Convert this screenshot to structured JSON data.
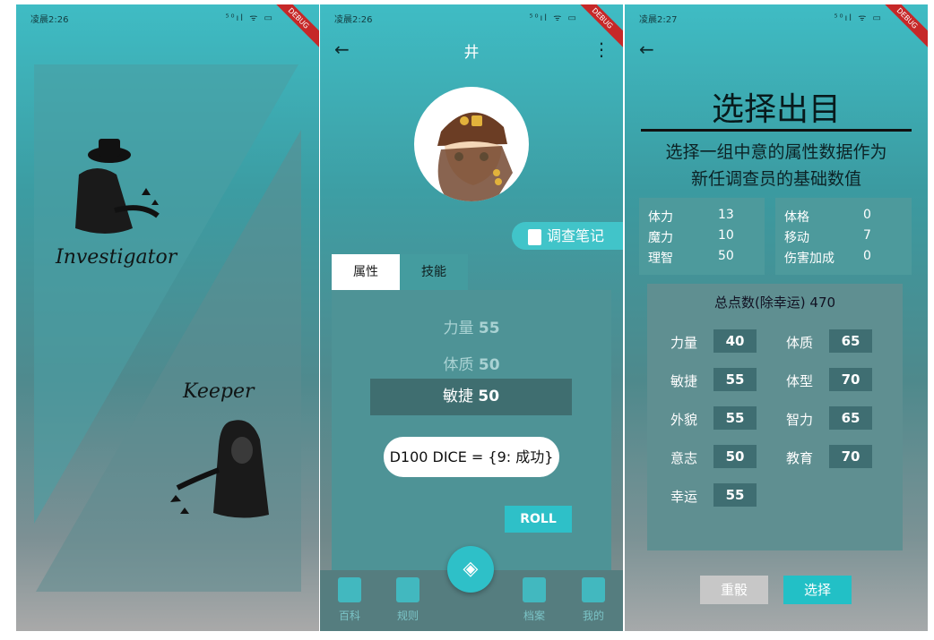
{
  "status": {
    "time1": "凌晨2:26",
    "time2": "凌晨2:26",
    "time3": "凌晨2:27",
    "icons": "⁵⁰ıl ᯤ ▭",
    "debug": "DEBUG"
  },
  "screen1": {
    "investigator": "Investigator",
    "keeper": "Keeper"
  },
  "screen2": {
    "title": "井",
    "notes_button": "调查笔记",
    "tabs": [
      "属性",
      "技能"
    ],
    "attributes": [
      {
        "name": "力量",
        "value": "55"
      },
      {
        "name": "体质",
        "value": "50"
      },
      {
        "name": "敏捷",
        "value": "50"
      }
    ],
    "dice_result": "D100 DICE = {9: 成功}",
    "roll_button": "ROLL",
    "nav": [
      "百科",
      "规则",
      "档案",
      "我的"
    ]
  },
  "screen3": {
    "title": "选择出目",
    "subtitle_line1": "选择一组中意的属性数据作为",
    "subtitle_line2": "新任调查员的基础数值",
    "derived_left": [
      {
        "name": "体力",
        "value": "13"
      },
      {
        "name": "魔力",
        "value": "10"
      },
      {
        "name": "理智",
        "value": "50"
      }
    ],
    "derived_right": [
      {
        "name": "体格",
        "value": "0"
      },
      {
        "name": "移动",
        "value": "7"
      },
      {
        "name": "伤害加成",
        "value": "0"
      }
    ],
    "total": "总点数(除幸运) 470",
    "points": [
      {
        "name": "力量",
        "value": "40"
      },
      {
        "name": "体质",
        "value": "65"
      },
      {
        "name": "敏捷",
        "value": "55"
      },
      {
        "name": "体型",
        "value": "70"
      },
      {
        "name": "外貌",
        "value": "55"
      },
      {
        "name": "智力",
        "value": "65"
      },
      {
        "name": "意志",
        "value": "50"
      },
      {
        "name": "教育",
        "value": "70"
      },
      {
        "name": "幸运",
        "value": "55"
      }
    ],
    "reset_button": "重骰",
    "select_button": "选择"
  }
}
